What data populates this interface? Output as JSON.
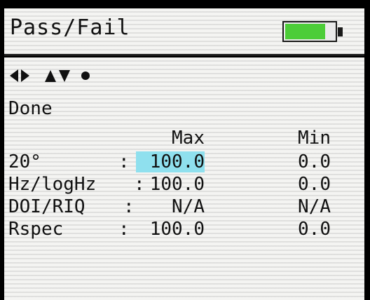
{
  "header": {
    "title": "Pass/Fail",
    "battery_level": 0.82,
    "battery_color": "#4ccd38"
  },
  "nav_icons": [
    "left-right-arrows-icon",
    "up-down-arrows-icon",
    "dot-select-icon"
  ],
  "status": "Done",
  "table": {
    "col_max": "Max",
    "col_min": "Min",
    "rows": [
      {
        "label": "20°",
        "colon": ":",
        "max": "100.0",
        "min": "0.0",
        "selected": true
      },
      {
        "label": "Hz/logHz",
        "colon": ":",
        "max": "100.0",
        "min": "0.0"
      },
      {
        "label": "DOI/RIQ",
        "colon": ":",
        "max": "N/A",
        "min": "N/A"
      },
      {
        "label": "Rspec",
        "colon": ":",
        "max": "100.0",
        "min": "0.0"
      }
    ]
  },
  "colors": {
    "highlight": "#8fe0ee",
    "screen_bg": "#f4f4f2",
    "text": "#111111"
  }
}
